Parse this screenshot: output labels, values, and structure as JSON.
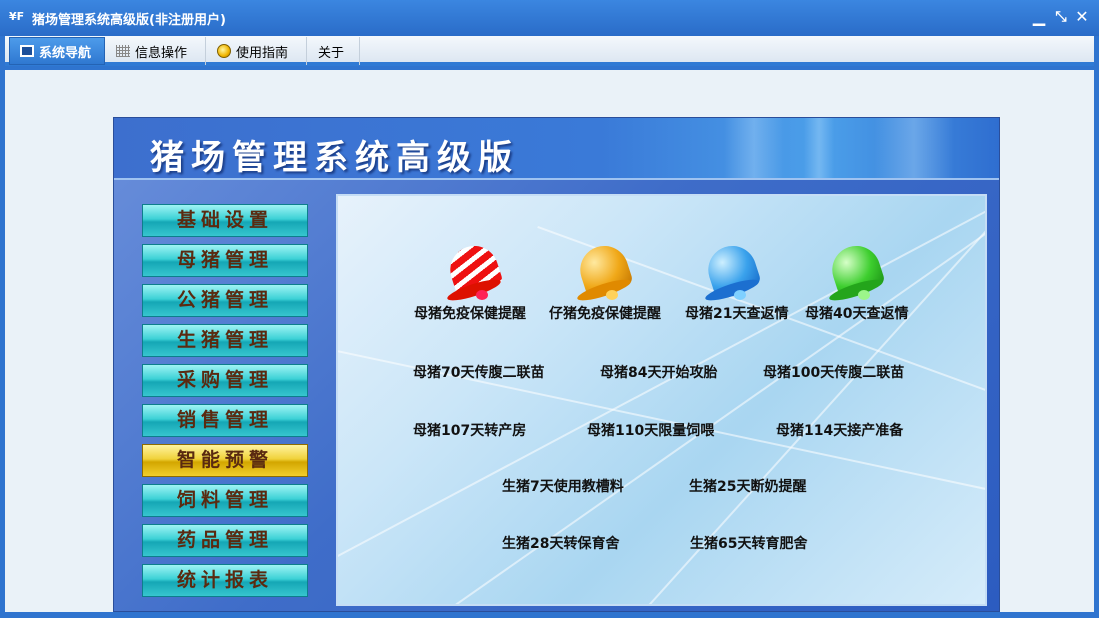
{
  "window": {
    "title": "猪场管理系统高级版(非注册用户)",
    "icon": "app-logo-icon"
  },
  "tabs": [
    {
      "label": "系统导航",
      "icon": "monitor-icon",
      "active": true
    },
    {
      "label": "信息操作",
      "icon": "grid-icon"
    },
    {
      "label": "使用指南",
      "icon": "bulb-icon"
    },
    {
      "label": "关于"
    }
  ],
  "banner": {
    "title": "猪场管理系统高级版"
  },
  "nav": [
    {
      "label": "基础设置"
    },
    {
      "label": "母猪管理"
    },
    {
      "label": "公猪管理"
    },
    {
      "label": "生猪管理"
    },
    {
      "label": "采购管理"
    },
    {
      "label": "销售管理"
    },
    {
      "label": "智能预警",
      "active": true
    },
    {
      "label": "饲料管理"
    },
    {
      "label": "药品管理"
    },
    {
      "label": "统计报表"
    }
  ],
  "bells": [
    {
      "label": "母猪免疫保健提醒",
      "color": "#e01010",
      "icon": "red-bell-icon"
    },
    {
      "label": "仔猪免疫保健提醒",
      "color": "#f0a818",
      "icon": "orange-bell-icon"
    },
    {
      "label": "母猪21天查返情",
      "color": "#2f8ee8",
      "icon": "blue-bell-icon"
    },
    {
      "label": "母猪40天查返情",
      "color": "#2fbf22",
      "icon": "green-bell-icon"
    }
  ],
  "reminders": [
    {
      "label": "母猪70天传腹二联苗"
    },
    {
      "label": "母猪84天开始攻胎"
    },
    {
      "label": "母猪100天传腹二联苗"
    },
    {
      "label": "母猪107天转产房"
    },
    {
      "label": "母猪110天限量饲喂"
    },
    {
      "label": "母猪114天接产准备"
    },
    {
      "label": "生猪7天使用教槽料"
    },
    {
      "label": "生猪25天断奶提醒"
    },
    {
      "label": "生猪28天转保育舍"
    },
    {
      "label": "生猪65天转育肥舍"
    }
  ]
}
